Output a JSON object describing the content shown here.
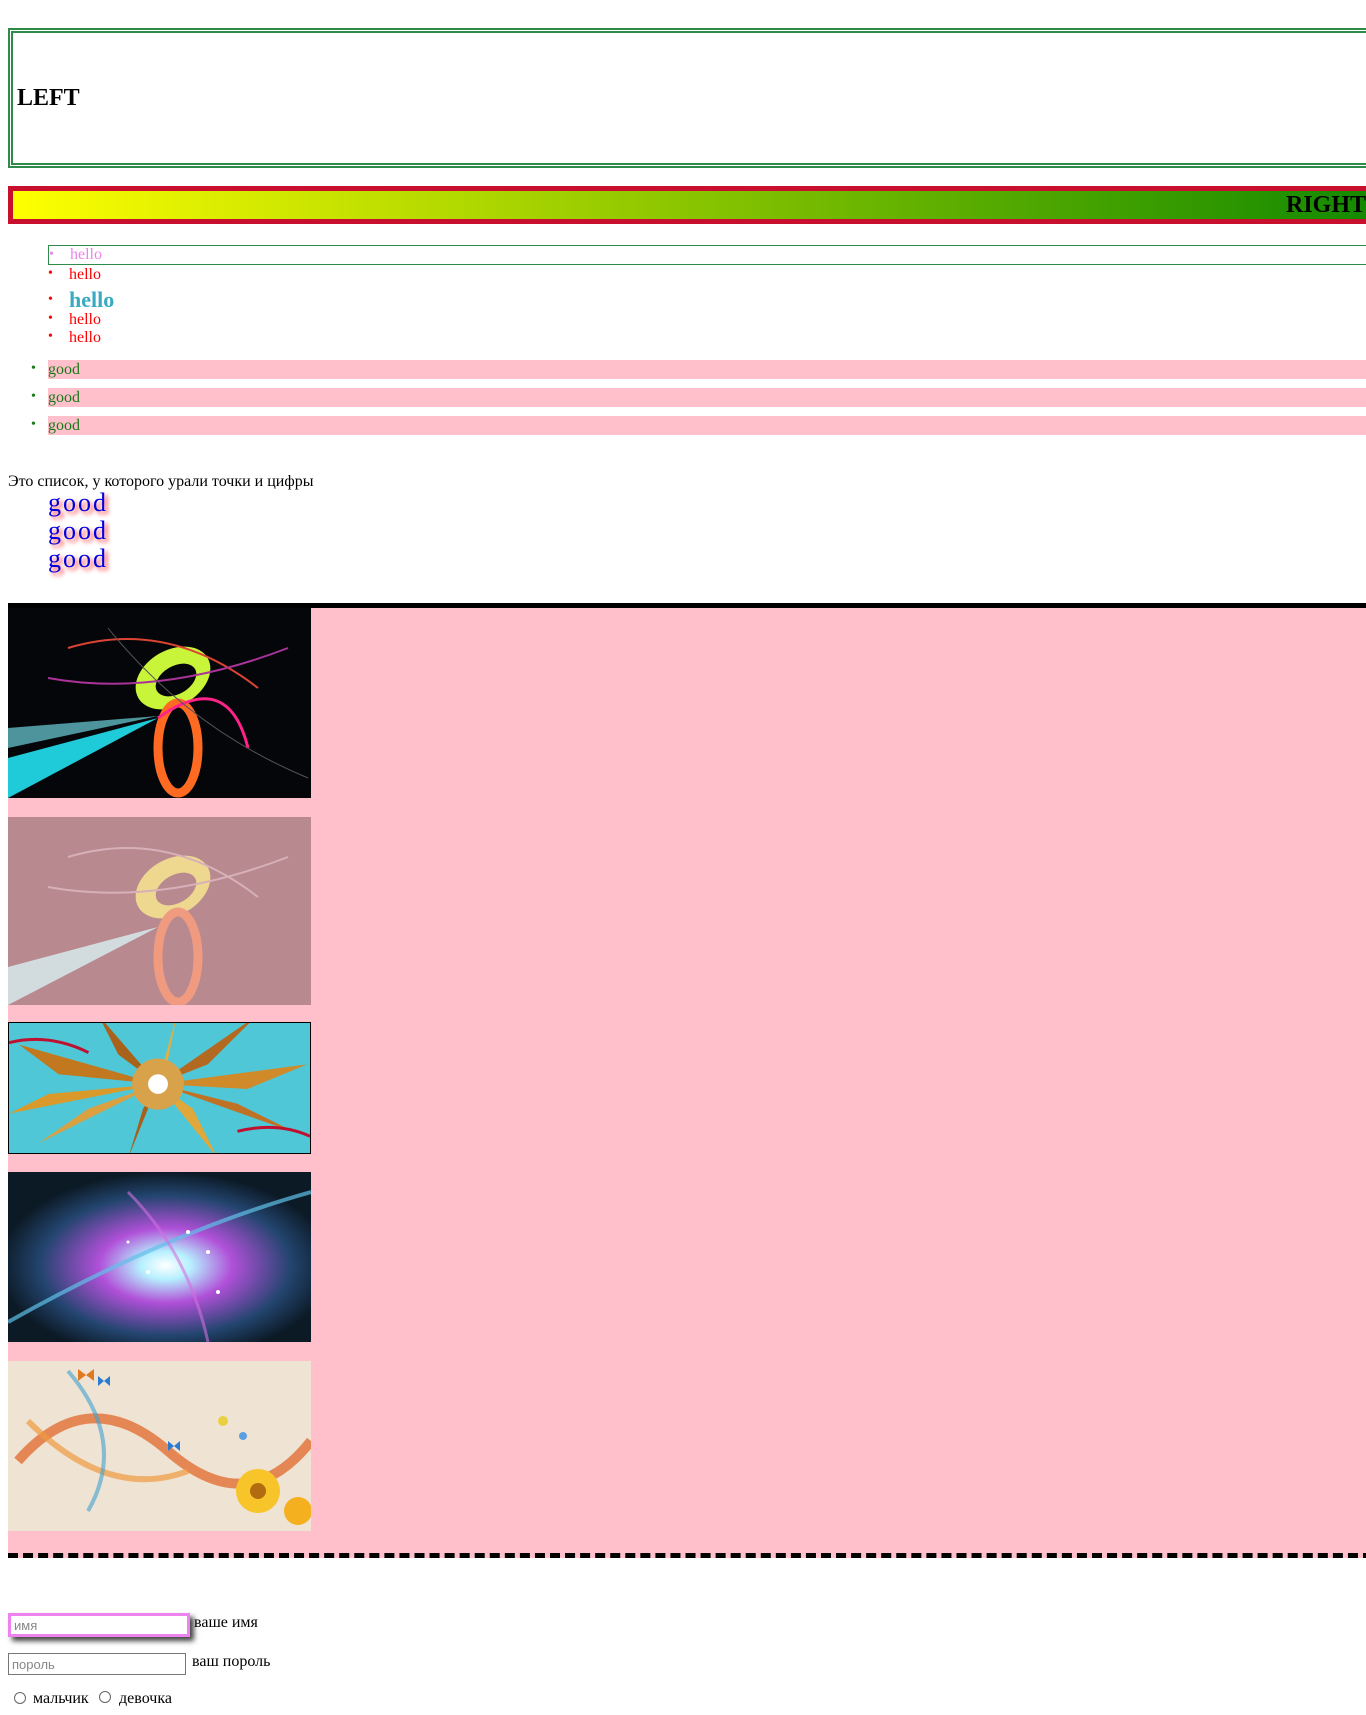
{
  "header": {
    "left_title": "LEFT",
    "right_title": "RIGHT"
  },
  "list_hello": [
    "hello",
    "hello",
    "hello",
    "hello",
    "hello"
  ],
  "list_good": [
    "good",
    "good",
    "good"
  ],
  "no_marker_list": {
    "caption": "Это список, у которого урали точки и цифры",
    "items": [
      "good",
      "good",
      "good"
    ]
  },
  "bullet_glyph": "•",
  "colors": {
    "left_border": "#2e8b4a",
    "right_border": "#c8102e",
    "gradient_start": "#ffff00",
    "gradient_end": "#148a00",
    "gallery_bg": "#ffc0cb"
  },
  "gallery": {
    "images": [
      {
        "name": "abstract-swirl-dark-image"
      },
      {
        "name": "abstract-swirl-faded-image"
      },
      {
        "name": "stained-glass-sun-image"
      },
      {
        "name": "cosmic-light-burst-image"
      },
      {
        "name": "butterflies-flowers-image"
      }
    ]
  },
  "form": {
    "name_placeholder": "имя",
    "name_label": "ваше имя",
    "password_placeholder": "пороль",
    "password_label": "ваш пороль",
    "radio_boy": "мальчик",
    "radio_girl": "девочка"
  }
}
